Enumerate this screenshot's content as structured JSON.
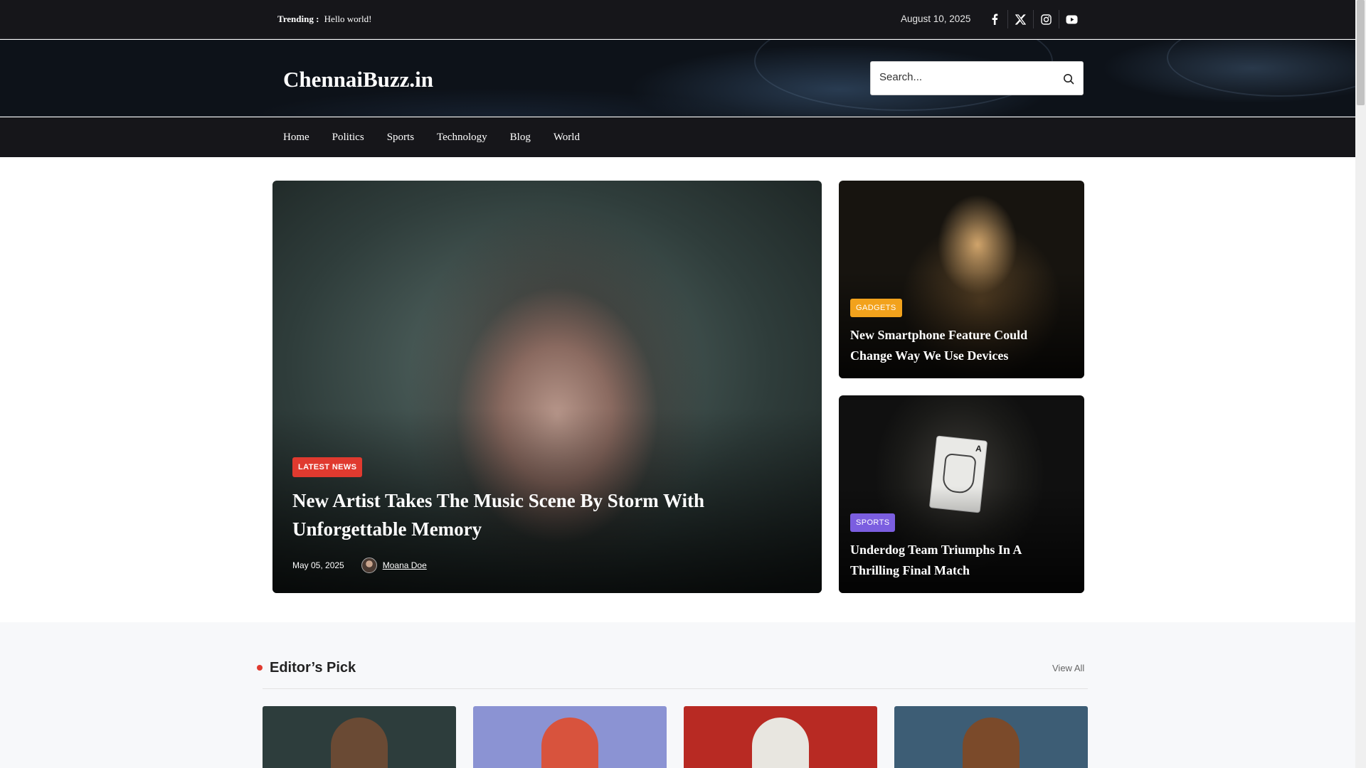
{
  "topbar": {
    "trending_label": "Trending :",
    "trending_value": "Hello world!",
    "date": "August 10, 2025",
    "social_icons": [
      "facebook-icon",
      "x-icon",
      "instagram-icon",
      "youtube-icon"
    ]
  },
  "header": {
    "logo": "ChennaiBuzz.in",
    "search_placeholder": "Search..."
  },
  "nav": {
    "items": [
      "Home",
      "Politics",
      "Sports",
      "Technology",
      "Blog",
      "World"
    ]
  },
  "hero": {
    "badge": "LATEST NEWS",
    "title": "New Artist Takes The Music Scene By Storm With Unforgettable Memory",
    "date": "May 05, 2025",
    "author": "Moana Doe"
  },
  "side_posts": [
    {
      "badge": "GADGETS",
      "title": "New Smartphone Feature Could Change Way We Use Devices"
    },
    {
      "badge": "SPORTS",
      "title": "Underdog Team Triumphs In A Thrilling Final Match"
    }
  ],
  "editors_pick": {
    "title": "Editor’s Pick",
    "view_all": "View All"
  },
  "colors": {
    "accent_red": "#e03a2f",
    "gadgets_orange": "#f2a21c",
    "sports_purple": "#7b5ee0",
    "dark_bar": "#16161a"
  }
}
